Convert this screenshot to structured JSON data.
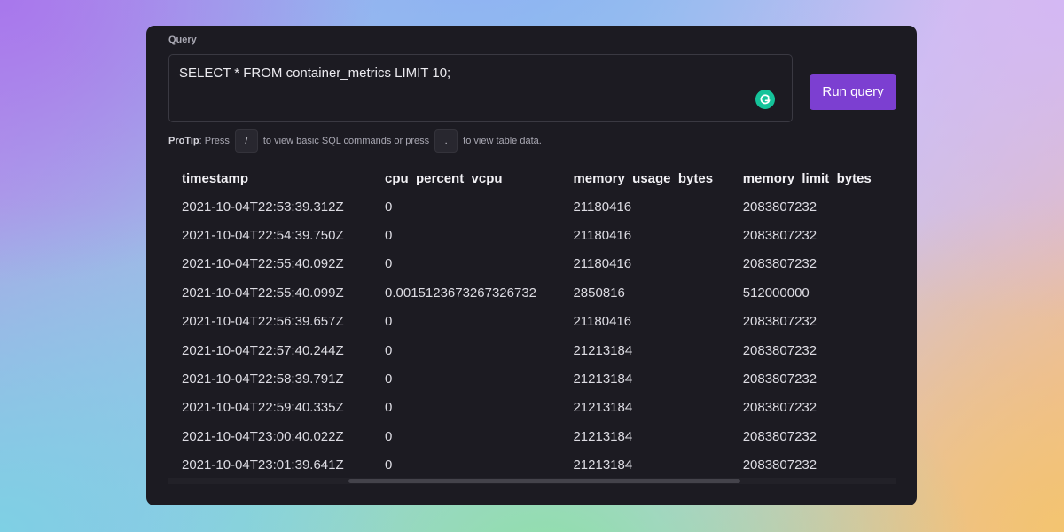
{
  "query": {
    "label": "Query",
    "text": "SELECT * FROM container_metrics LIMIT 10;",
    "run_label": "Run query"
  },
  "protip": {
    "lead": "ProTip",
    "part1": ": Press",
    "key1": "/",
    "part2": "to view basic SQL commands or press",
    "key2": ".",
    "part3": "to view table data."
  },
  "table": {
    "headers": [
      "timestamp",
      "cpu_percent_vcpu",
      "memory_usage_bytes",
      "memory_limit_bytes"
    ],
    "rows": [
      [
        "2021-10-04T22:53:39.312Z",
        "0",
        "21180416",
        "2083807232"
      ],
      [
        "2021-10-04T22:54:39.750Z",
        "0",
        "21180416",
        "2083807232"
      ],
      [
        "2021-10-04T22:55:40.092Z",
        "0",
        "21180416",
        "2083807232"
      ],
      [
        "2021-10-04T22:55:40.099Z",
        "0.0015123673267326732",
        "2850816",
        "512000000"
      ],
      [
        "2021-10-04T22:56:39.657Z",
        "0",
        "21180416",
        "2083807232"
      ],
      [
        "2021-10-04T22:57:40.244Z",
        "0",
        "21213184",
        "2083807232"
      ],
      [
        "2021-10-04T22:58:39.791Z",
        "0",
        "21213184",
        "2083807232"
      ],
      [
        "2021-10-04T22:59:40.335Z",
        "0",
        "21213184",
        "2083807232"
      ],
      [
        "2021-10-04T23:00:40.022Z",
        "0",
        "21213184",
        "2083807232"
      ],
      [
        "2021-10-04T23:01:39.641Z",
        "0",
        "21213184",
        "2083807232"
      ]
    ]
  },
  "icons": {
    "grammarly": "grammarly-icon"
  },
  "colors": {
    "accent": "#7c3fd1",
    "panel_bg": "#1c1b22",
    "grammarly": "#15c39a"
  }
}
